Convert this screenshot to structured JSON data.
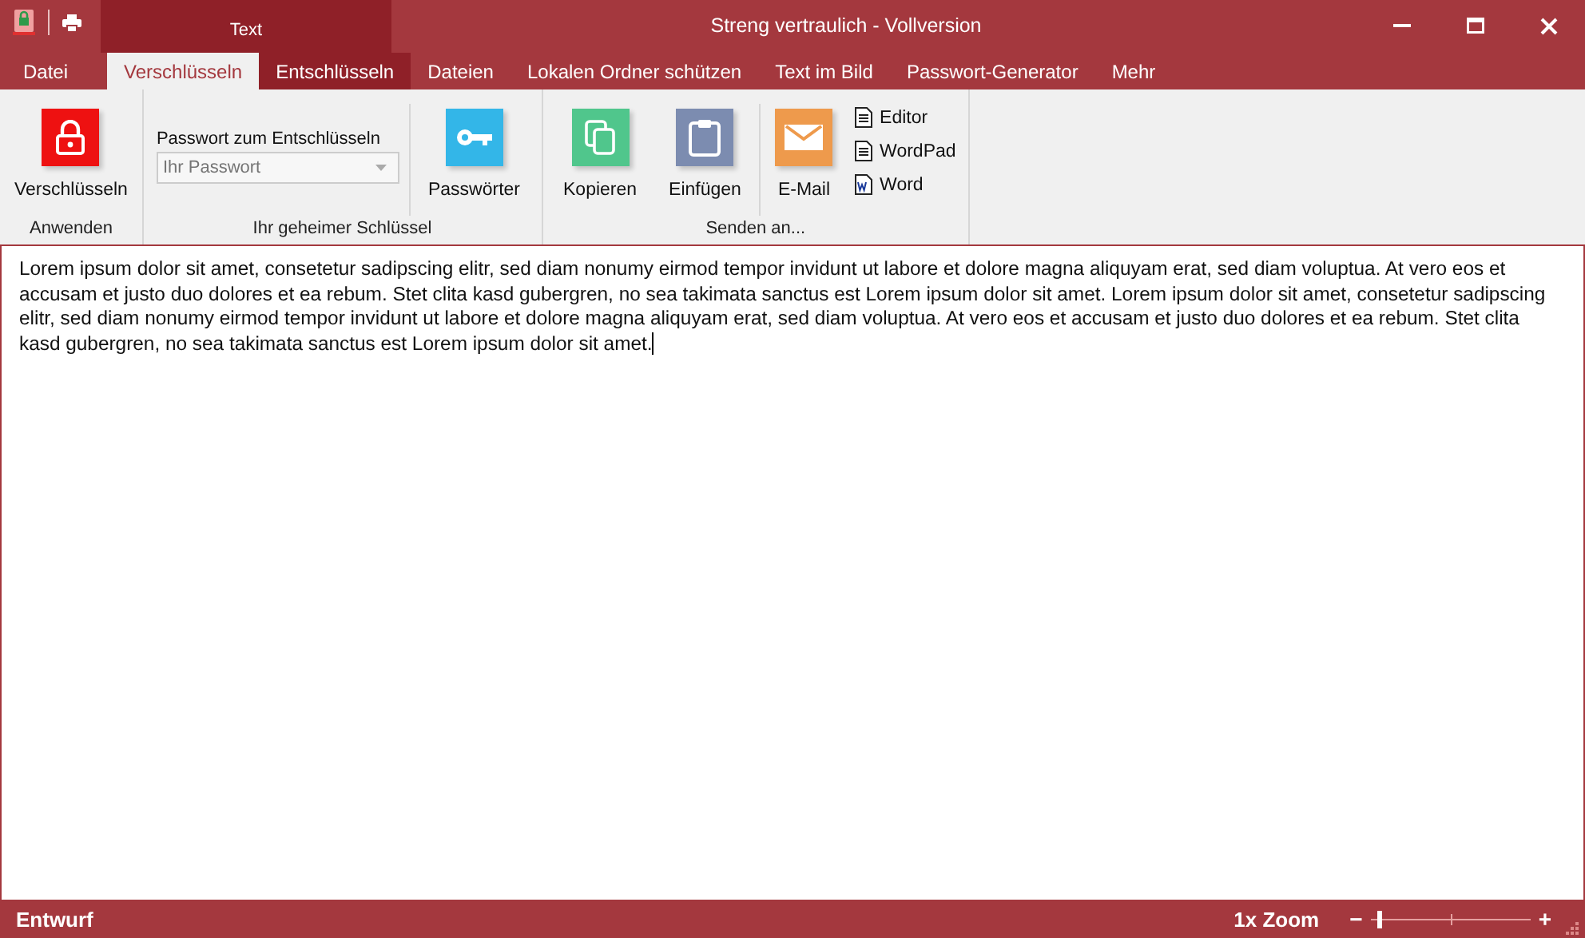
{
  "window": {
    "title": "Streng vertraulich  -  Vollversion",
    "context_tab": "Text"
  },
  "tabs": [
    {
      "label": "Datei",
      "selected": false,
      "context": false
    },
    {
      "label": "Verschlüsseln",
      "selected": true,
      "context": true
    },
    {
      "label": "Entschlüsseln",
      "selected": false,
      "context": true
    },
    {
      "label": "Dateien",
      "selected": false,
      "context": false
    },
    {
      "label": "Lokalen Ordner schützen",
      "selected": false,
      "context": false
    },
    {
      "label": "Text im Bild",
      "selected": false,
      "context": false
    },
    {
      "label": "Passwort-Generator",
      "selected": false,
      "context": false
    },
    {
      "label": "Mehr",
      "selected": false,
      "context": false
    }
  ],
  "ribbon": {
    "groups": [
      {
        "label": "Anwenden",
        "items": [
          {
            "kind": "big",
            "label": "Verschlüsseln"
          }
        ]
      },
      {
        "label": "Ihr geheimer Schlüssel",
        "items": [
          {
            "kind": "combo",
            "label": "Passwort zum Entschlüsseln",
            "placeholder": "Ihr Passwort"
          },
          {
            "kind": "sep"
          },
          {
            "kind": "big",
            "label": "Passwörter"
          }
        ]
      },
      {
        "label": "Senden an...",
        "items": [
          {
            "kind": "big",
            "label": "Kopieren"
          },
          {
            "kind": "big",
            "label": "Einfügen"
          },
          {
            "kind": "sep"
          },
          {
            "kind": "big",
            "label": "E-Mail"
          },
          {
            "kind": "small",
            "items": [
              {
                "label": "Editor"
              },
              {
                "label": "WordPad"
              },
              {
                "label": "Word"
              }
            ]
          }
        ]
      }
    ]
  },
  "editor": {
    "value": "Lorem ipsum dolor sit amet, consetetur sadipscing elitr, sed diam nonumy eirmod tempor invidunt ut labore et dolore magna aliquyam erat, sed diam voluptua. At vero eos et accusam et justo duo dolores et ea rebum. Stet clita kasd gubergren, no sea takimata sanctus est Lorem ipsum dolor sit amet. Lorem ipsum dolor sit amet, consetetur sadipscing elitr, sed diam nonumy eirmod tempor invidunt ut labore et dolore magna aliquyam erat, sed diam voluptua. At vero eos et accusam et justo duo dolores et ea rebum. Stet clita kasd gubergren, no sea takimata sanctus est Lorem ipsum dolor sit amet."
  },
  "status_bar": {
    "state": "Entwurf",
    "zoom_label": "1x Zoom",
    "zoom_minus": "−",
    "zoom_plus": "+",
    "zoom": {
      "level": 0.05
    }
  }
}
